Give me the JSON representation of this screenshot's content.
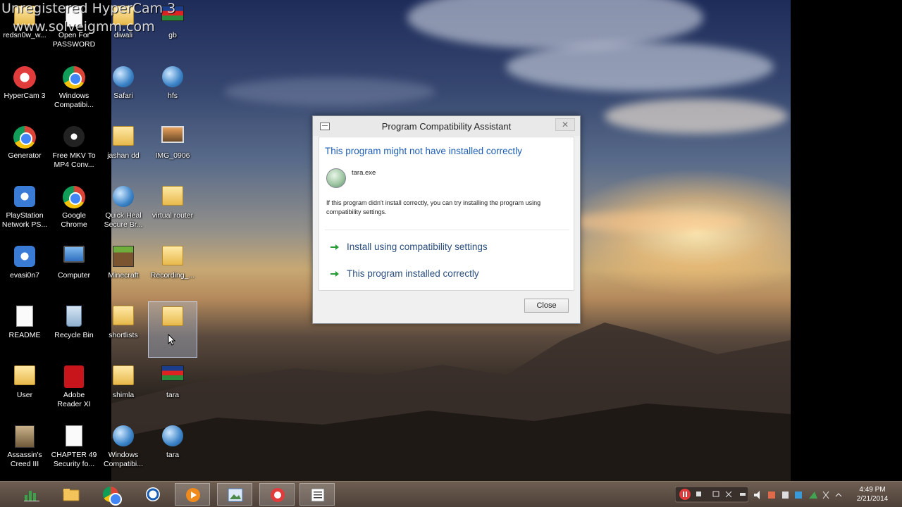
{
  "watermark": {
    "line1": "Unregistered HyperCam 3",
    "line2": "www.solveigmm.com"
  },
  "desktop_icons": [
    {
      "label": "redsn0w_w...",
      "icon": "folder"
    },
    {
      "label": "Open For\nPASSWORD",
      "icon": "document"
    },
    {
      "label": "diwali",
      "icon": "folder"
    },
    {
      "label": "gb",
      "icon": "flag"
    },
    {
      "label": "HyperCam 3",
      "icon": "hypercam"
    },
    {
      "label": "Windows\nCompatibi...",
      "icon": "chrome"
    },
    {
      "label": "Safari",
      "icon": "safari"
    },
    {
      "label": "hfs",
      "icon": "globe"
    },
    {
      "label": "Generator",
      "icon": "chrome"
    },
    {
      "label": "Free MKV To\nMP4 Conv...",
      "icon": "film"
    },
    {
      "label": "jashan dd",
      "icon": "folder"
    },
    {
      "label": "IMG_0906",
      "icon": "photo"
    },
    {
      "label": "PlayStation\nNetwork PS...",
      "icon": "gear"
    },
    {
      "label": "Google\nChrome",
      "icon": "chrome"
    },
    {
      "label": "Quick Heal\nSecure Br...",
      "icon": "globe"
    },
    {
      "label": "virtual router",
      "icon": "folder"
    },
    {
      "label": "evasi0n7",
      "icon": "gear"
    },
    {
      "label": "Computer",
      "icon": "computer"
    },
    {
      "label": "Minecraft",
      "icon": "grass"
    },
    {
      "label": "Recording_...",
      "icon": "folder"
    },
    {
      "label": "README",
      "icon": "document"
    },
    {
      "label": "Recycle Bin",
      "icon": "recycle-bin"
    },
    {
      "label": "shortlists",
      "icon": "folder"
    },
    {
      "label": "",
      "icon": "folder"
    },
    {
      "label": "User",
      "icon": "folder"
    },
    {
      "label": "Adobe\nReader XI",
      "icon": "pdf"
    },
    {
      "label": "shimla",
      "icon": "folder"
    },
    {
      "label": "tara",
      "icon": "flag"
    },
    {
      "label": "Assassin's\nCreed III",
      "icon": "figure"
    },
    {
      "label": "CHAPTER 49\nSecurity fo...",
      "icon": "document"
    },
    {
      "label": "Windows\nCompatibi...",
      "icon": "windows"
    },
    {
      "label": "tara",
      "icon": "globe"
    }
  ],
  "dialog": {
    "title": "Program Compatibility Assistant",
    "close_glyph": "✕",
    "heading": "This program might not have installed correctly",
    "app_name": "tara.exe",
    "description": "If this program didn't install correctly, you can try installing the program using compatibility settings.",
    "options": [
      {
        "label": "Install using compatibility settings"
      },
      {
        "label": "This program installed correctly"
      }
    ],
    "close_button": "Close",
    "heading_color": "#1e5fb4",
    "arrow_color": "#2a9d3a"
  },
  "taskbar": {
    "items": [
      {
        "name": "excel-like-app",
        "icon": "chart"
      },
      {
        "name": "file-explorer",
        "icon": "folder"
      },
      {
        "name": "chrome",
        "icon": "chrome"
      },
      {
        "name": "ie-app",
        "icon": "circle"
      },
      {
        "name": "media-player",
        "icon": "play"
      },
      {
        "name": "paint",
        "icon": "picture"
      },
      {
        "name": "hypercam",
        "icon": "record"
      },
      {
        "name": "notepad",
        "icon": "list"
      }
    ],
    "clock": {
      "time": "4:49 PM",
      "date": "2/21/2014"
    }
  }
}
